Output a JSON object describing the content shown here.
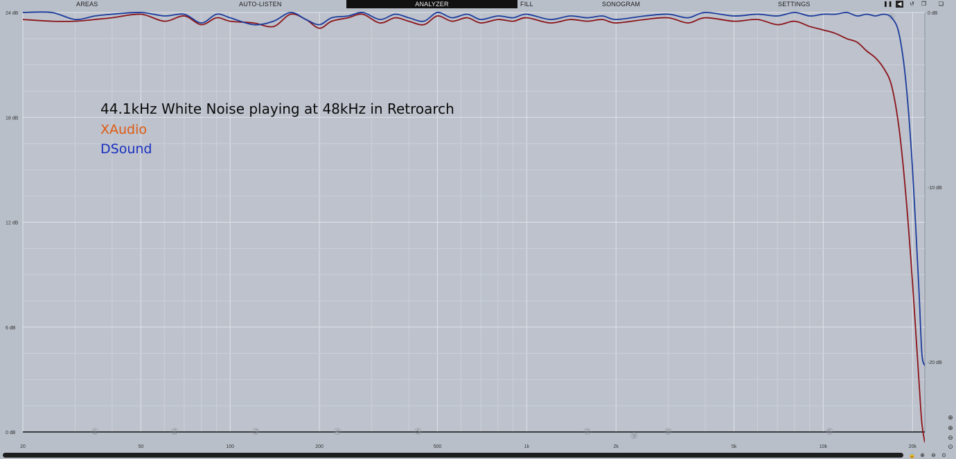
{
  "toolbar": {
    "tabs": [
      {
        "label": "AREAS"
      },
      {
        "label": "AUTO-LISTEN"
      },
      {
        "label": "ANALYZER",
        "active": true
      },
      {
        "label": "FILL"
      },
      {
        "label": "SONOGRAM"
      },
      {
        "label": "SETTINGS"
      }
    ],
    "icons": [
      "pause-icon",
      "speaker-icon",
      "reset-icon",
      "copy-icon",
      "paste-icon"
    ]
  },
  "annotation": {
    "title": "44.1kHz White Noise playing at 48kHz in Retroarch",
    "line1": "XAudio",
    "line2": "DSound",
    "line1_color": "#e05a10",
    "line2_color": "#1a2fc0"
  },
  "chart_data": {
    "type": "line",
    "x_scale": "log",
    "xlim": [
      20,
      22000
    ],
    "ylim_left": [
      0,
      24
    ],
    "ylim_right": [
      -24,
      0
    ],
    "y_ticks_left": [
      {
        "value": 0,
        "label": "0 dB"
      },
      {
        "value": 6,
        "label": "6 dB"
      },
      {
        "value": 12,
        "label": "12 dB"
      },
      {
        "value": 18,
        "label": "18 dB"
      },
      {
        "value": 24,
        "label": "24 dB"
      }
    ],
    "y_ticks_right": [
      {
        "value": 0,
        "label": "0 dB"
      },
      {
        "value": -10,
        "label": "-10 dB"
      },
      {
        "value": -20,
        "label": "-20 dB"
      }
    ],
    "x_ticks": [
      {
        "value": 20,
        "label": "20"
      },
      {
        "value": 50,
        "label": "50"
      },
      {
        "value": 100,
        "label": "100"
      },
      {
        "value": 200,
        "label": "200"
      },
      {
        "value": 500,
        "label": "500"
      },
      {
        "value": 1000,
        "label": "1k"
      },
      {
        "value": 2000,
        "label": "2k"
      },
      {
        "value": 5000,
        "label": "5k"
      },
      {
        "value": 10000,
        "label": "10k"
      },
      {
        "value": 20000,
        "label": "20k"
      }
    ],
    "band_markers": [
      {
        "label": "①",
        "freq": 35
      },
      {
        "label": "②",
        "freq": 65
      },
      {
        "label": "③",
        "freq": 122
      },
      {
        "label": "④",
        "freq": 230
      },
      {
        "label": "⑤",
        "freq": 430
      },
      {
        "label": "⑦",
        "freq": 1600
      },
      {
        "label": "⑨",
        "freq": 2300
      },
      {
        "label": "⑧",
        "freq": 3000
      },
      {
        "label": "⑥",
        "freq": 10500
      }
    ],
    "top_marker": {
      "label": "⑤",
      "freq": 17000
    },
    "grid": true,
    "series": [
      {
        "name": "XAudio",
        "color": "#8b1218",
        "x": [
          20,
          25,
          30,
          35,
          40,
          50,
          60,
          70,
          80,
          90,
          100,
          120,
          140,
          160,
          180,
          200,
          220,
          250,
          280,
          320,
          360,
          400,
          450,
          500,
          560,
          630,
          700,
          800,
          900,
          1000,
          1200,
          1400,
          1600,
          1800,
          2000,
          2500,
          3000,
          3500,
          4000,
          5000,
          6000,
          7000,
          8000,
          9000,
          10000,
          11000,
          12000,
          13000,
          14000,
          15000,
          16000,
          17000,
          18000,
          19000,
          20000,
          21000,
          21500,
          22000
        ],
        "values": [
          23.6,
          23.5,
          23.5,
          23.6,
          23.7,
          23.9,
          23.5,
          23.8,
          23.3,
          23.7,
          23.5,
          23.4,
          23.2,
          23.9,
          23.6,
          23.1,
          23.5,
          23.7,
          23.9,
          23.4,
          23.7,
          23.5,
          23.3,
          23.8,
          23.5,
          23.7,
          23.4,
          23.6,
          23.5,
          23.7,
          23.4,
          23.6,
          23.5,
          23.6,
          23.4,
          23.6,
          23.7,
          23.4,
          23.7,
          23.5,
          23.6,
          23.3,
          23.5,
          23.2,
          23.0,
          22.8,
          22.5,
          22.3,
          21.8,
          21.4,
          20.8,
          19.8,
          17.4,
          13.5,
          8.5,
          3.0,
          0.5,
          -0.6
        ]
      },
      {
        "name": "DSound",
        "color": "#1a3a9c",
        "x": [
          20,
          25,
          30,
          35,
          40,
          50,
          60,
          70,
          80,
          90,
          100,
          120,
          140,
          160,
          180,
          200,
          220,
          250,
          280,
          320,
          360,
          400,
          450,
          500,
          560,
          630,
          700,
          800,
          900,
          1000,
          1200,
          1400,
          1600,
          1800,
          2000,
          2500,
          3000,
          3500,
          4000,
          5000,
          6000,
          7000,
          8000,
          9000,
          10000,
          11000,
          12000,
          13000,
          14000,
          15000,
          16000,
          17000,
          18000,
          19000,
          20000,
          21000,
          21500,
          22000
        ],
        "values": [
          24.0,
          24.0,
          23.6,
          23.8,
          23.9,
          24.0,
          23.8,
          23.9,
          23.4,
          23.9,
          23.7,
          23.3,
          23.5,
          24.0,
          23.6,
          23.3,
          23.7,
          23.8,
          24.0,
          23.6,
          23.9,
          23.7,
          23.5,
          24.0,
          23.7,
          23.9,
          23.6,
          23.8,
          23.7,
          23.9,
          23.6,
          23.8,
          23.7,
          23.8,
          23.6,
          23.8,
          23.9,
          23.7,
          24.0,
          23.8,
          23.9,
          23.8,
          24.0,
          23.8,
          23.9,
          23.9,
          24.0,
          23.8,
          23.9,
          23.8,
          23.9,
          23.7,
          22.8,
          20.0,
          15.0,
          8.2,
          4.5,
          3.8
        ]
      }
    ]
  }
}
